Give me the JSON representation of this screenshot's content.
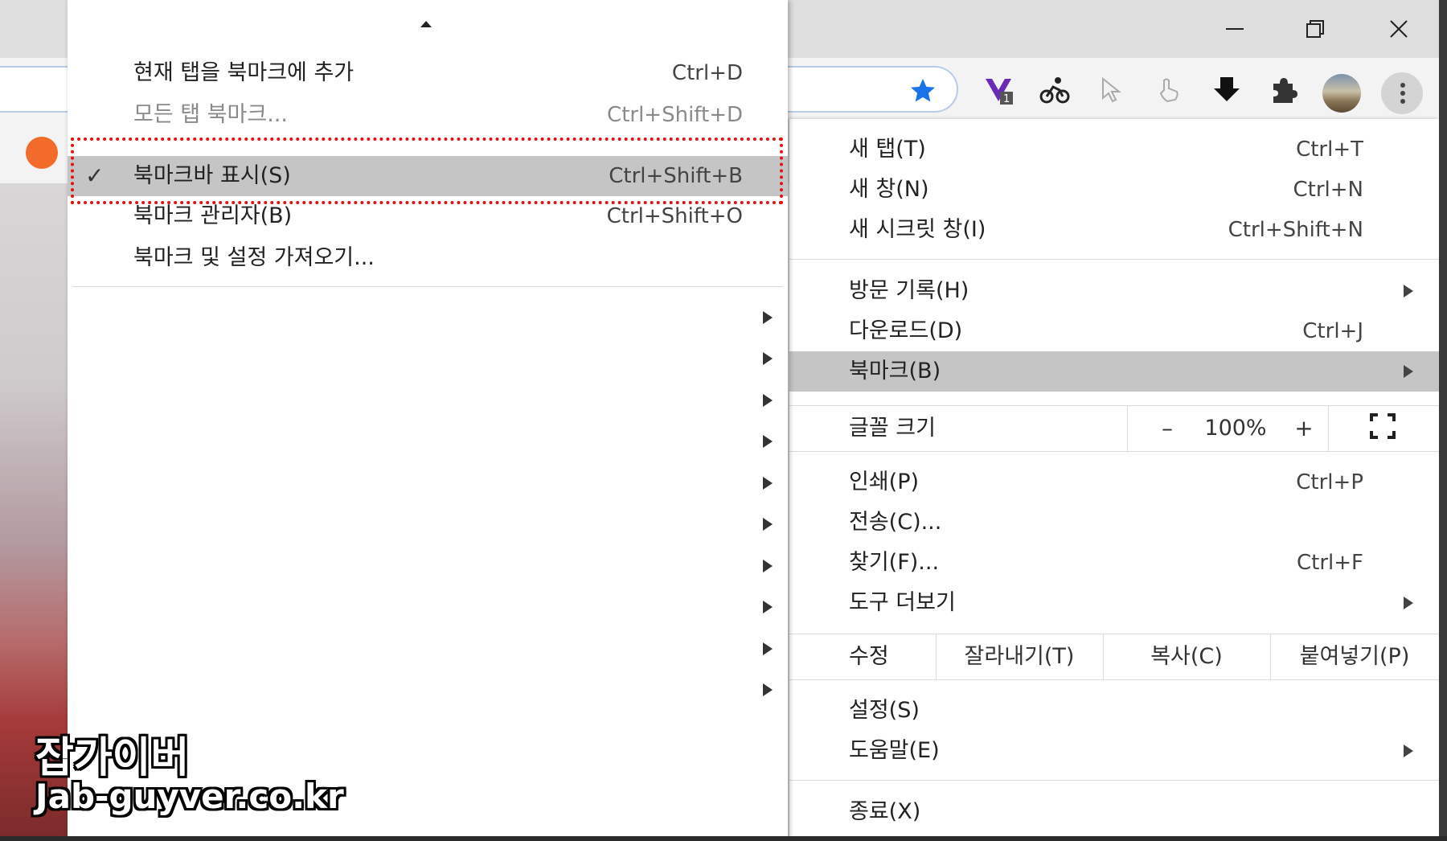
{
  "window_controls": {
    "minimize_icon": "minimize-icon",
    "restore_icon": "restore-icon",
    "close_icon": "close-icon"
  },
  "colors": {
    "accent_star": "#1a73e8",
    "highlight": "#c5c5c5",
    "annotation": "#e01212"
  },
  "extensions": [
    {
      "name": "vue-devtools-icon",
      "badge": "1"
    },
    {
      "name": "cyclist-icon"
    },
    {
      "name": "cursor-icon"
    },
    {
      "name": "hand-pointer-icon"
    },
    {
      "name": "download-arrow-icon"
    },
    {
      "name": "puzzle-icon"
    }
  ],
  "bookmark_submenu": {
    "items": [
      {
        "label": "현재 탭을 북마크에 추가",
        "shortcut": "Ctrl+D"
      },
      {
        "label": "모든 탭 북마크...",
        "shortcut": "Ctrl+Shift+D"
      },
      {
        "label": "북마크바 표시(S)",
        "shortcut": "Ctrl+Shift+B"
      },
      {
        "label": "북마크 관리자(B)",
        "shortcut": "Ctrl+Shift+O"
      },
      {
        "label": "북마크 및 설정 가져오기..."
      }
    ]
  },
  "main_menu": {
    "new_tab": {
      "label": "새 탭(T)",
      "shortcut": "Ctrl+T"
    },
    "new_window": {
      "label": "새 창(N)",
      "shortcut": "Ctrl+N"
    },
    "incognito": {
      "label": "새 시크릿 창(I)",
      "shortcut": "Ctrl+Shift+N"
    },
    "history": {
      "label": "방문 기록(H)"
    },
    "downloads": {
      "label": "다운로드(D)",
      "shortcut": "Ctrl+J"
    },
    "bookmarks": {
      "label": "북마크(B)"
    },
    "zoom": {
      "label": "글꼴 크기",
      "minus": "–",
      "value": "100%",
      "plus": "+"
    },
    "print": {
      "label": "인쇄(P)",
      "shortcut": "Ctrl+P"
    },
    "cast": {
      "label": "전송(C)..."
    },
    "find": {
      "label": "찾기(F)...",
      "shortcut": "Ctrl+F"
    },
    "more_tools": {
      "label": "도구 더보기"
    },
    "edit": {
      "label": "수정",
      "cut": "잘라내기(T)",
      "copy": "복사(C)",
      "paste": "붙여넣기(P)"
    },
    "settings": {
      "label": "설정(S)"
    },
    "help": {
      "label": "도움말(E)"
    },
    "exit": {
      "label": "종료(X)"
    }
  },
  "watermark": {
    "line1": "잡가이버",
    "line2": "Jab-guyver.co.kr"
  }
}
